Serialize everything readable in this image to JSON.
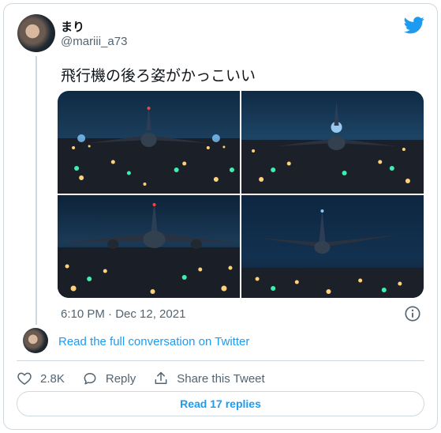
{
  "author": {
    "display_name": "まり",
    "handle": "@mariii_a73"
  },
  "tweet": {
    "text": "飛行機の後ろ姿がかっこいい",
    "timestamp": "6:10 PM · Dec 12, 2021",
    "media": [
      {
        "name": "photo-1",
        "description": "airplane rear view on night runway"
      },
      {
        "name": "photo-2",
        "description": "airplane rear view with blue beacon"
      },
      {
        "name": "photo-3",
        "description": "airplane rear view close"
      },
      {
        "name": "photo-4",
        "description": "airplane taking off over runway lights"
      }
    ]
  },
  "conversation": {
    "link_label": "Read the full conversation on Twitter"
  },
  "actions": {
    "like_count": "2.8K",
    "reply_label": "Reply",
    "share_label": "Share this Tweet"
  },
  "replies": {
    "button_label": "Read 17 replies"
  },
  "colors": {
    "accent": "#1d9bf0",
    "text_primary": "#0f1419",
    "text_secondary": "#536471",
    "border": "#cfd9de"
  },
  "icons": [
    "twitter-logo-icon",
    "info-icon",
    "heart-icon",
    "reply-icon",
    "share-icon"
  ]
}
